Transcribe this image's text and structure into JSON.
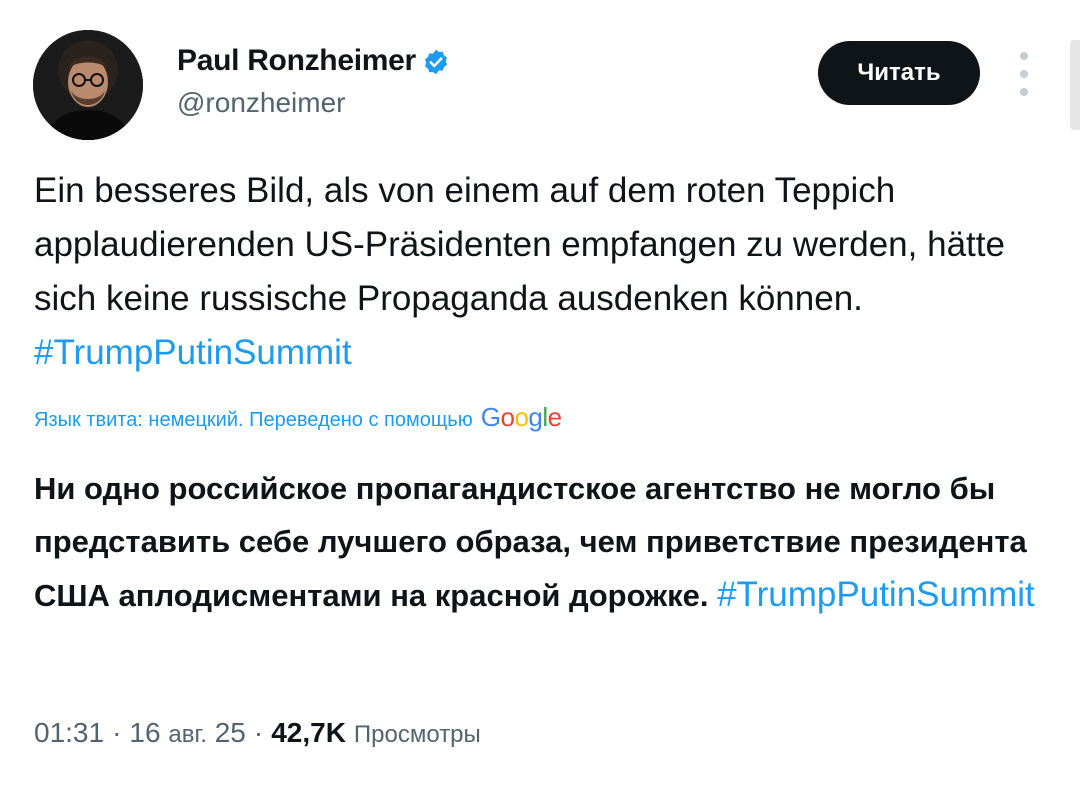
{
  "author": {
    "display_name": "Paul Ronzheimer",
    "handle": "@ronzheimer",
    "verified": true
  },
  "follow_button_label": "Читать",
  "tweet": {
    "text_plain": "Ein besseres Bild, als von einem auf dem roten Teppich applaudierenden US-Präsidenten empfangen zu werden, hätte sich keine russische Propaganda ausdenken können. ",
    "hashtag": "#TrumpPutinSummit"
  },
  "translation": {
    "note": "Язык твита: немецкий. Переведено с помощью",
    "provider_letters": [
      "G",
      "o",
      "o",
      "g",
      "l",
      "e"
    ],
    "text_plain": "Ни одно российское пропагандистское агентство не могло бы представить себе лучшего образа, чем приветствие президента США аплодисментами на красной дорожке. ",
    "hashtag": "#TrumpPutinSummit"
  },
  "meta": {
    "time": "01:31",
    "separator": "·",
    "day": "16",
    "month": "авг.",
    "year": "25",
    "views_count": "42,7K",
    "views_label": "Просмотры"
  },
  "colors": {
    "link": "#1d9bf0",
    "text": "#0f1419",
    "secondary": "#536471",
    "button_bg": "#0f1419"
  },
  "icons": [
    "avatar",
    "verified-badge-icon",
    "more-options-icon"
  ]
}
